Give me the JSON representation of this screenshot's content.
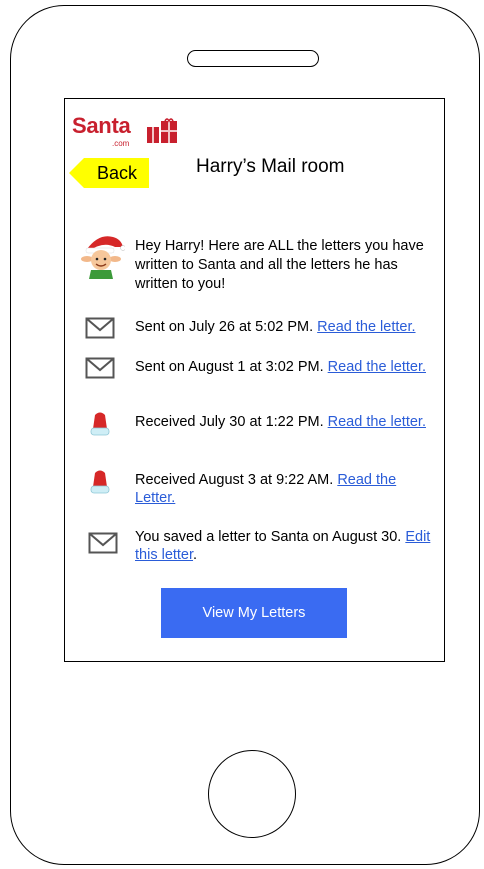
{
  "app": {
    "logo_text": "Santa",
    "logo_subtext": ".com",
    "back_label": "Back",
    "title": "Harry’s Mail room",
    "accent_color": "#3a6bf2",
    "link_color": "#2a5cd8",
    "brand_color": "#c8202e",
    "back_color": "#ffff00"
  },
  "intro": {
    "icon": "elf-avatar-icon",
    "text": "Hey Harry! Here are ALL the letters you have written to Santa and all the letters he has written to you!"
  },
  "items": [
    {
      "icon": "envelope-icon",
      "text": "Sent on July 26 at 5:02 PM. ",
      "link": "Read the letter."
    },
    {
      "icon": "envelope-icon",
      "text": "Sent on August 1 at 3:02 PM. ",
      "link": "Read the letter."
    },
    {
      "icon": "santa-hat-icon",
      "text": "Received July 30 at 1:22 PM. ",
      "link": "Read the letter."
    },
    {
      "icon": "santa-hat-icon",
      "text": "Received August 3 at 9:22 AM. ",
      "link": "Read the Letter."
    },
    {
      "icon": "envelope-icon",
      "text": "You saved a letter to Santa on August 30. ",
      "link": "Edit this letter",
      "suffix": "."
    }
  ],
  "view_button_label": "View My Letters"
}
